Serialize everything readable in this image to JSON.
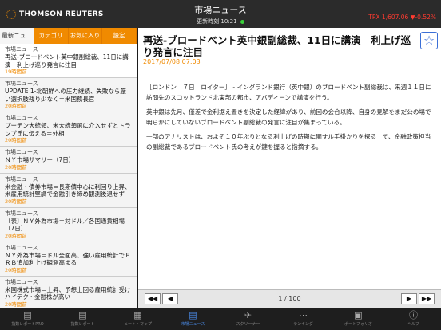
{
  "header": {
    "brand": "THOMSON REUTERS",
    "title": "市場ニュース",
    "updated_label": "更新時刻",
    "updated_time": "10:21",
    "ticker": "TPX 1,607.06 ▼-0.52%"
  },
  "tabs": [
    {
      "label": "最新ニュ..."
    },
    {
      "label": "カテゴリ"
    },
    {
      "label": "お気に入り"
    },
    {
      "label": "設定"
    }
  ],
  "news": [
    {
      "source": "市場ニュース",
      "title": "再送-ブロードベント英中銀副総裁、11日に講演　利上げ巡り発言に注目",
      "age": "19時間前"
    },
    {
      "source": "市場ニュース",
      "title": "UPDATE 1-北朝鮮への圧力継続、失敗なら厳い選択肢残り少なく＝米国務長官",
      "age": "20時間前"
    },
    {
      "source": "市場ニュース",
      "title": "プーチン大統領、米大統領選に介入せずとトランプ氏に伝える＝外相",
      "age": "20時間前"
    },
    {
      "source": "市場ニュース",
      "title": "ＮＹ市場サマリー（7日）",
      "age": "20時間前"
    },
    {
      "source": "市場ニュース",
      "title": "米金融・債券市場＝長期債中心に利回り上昇、米雇用統計堅調で金融引き締め観測後退せず",
      "age": "20時間前"
    },
    {
      "source": "市場ニュース",
      "title": "〔表〕ＮＹ外為市場＝対ドル／各国通貨相場（7日）",
      "age": "20時間前"
    },
    {
      "source": "市場ニュース",
      "title": "ＮＹ外為市場＝ドル全面高、強い雇用統計でＦＲＢ追加利上げ観測高まる",
      "age": "20時間前"
    },
    {
      "source": "市場ニュース",
      "title": "米国株式市場＝上昇、予想上回る雇用統計受け　ハイテク・金融株が高い",
      "age": "20時間前"
    }
  ],
  "article": {
    "title": "再送-ブロードベント英中銀副総裁、11日に講演　利上げ巡り発言に注目",
    "date": "2017/07/08 07:03",
    "paragraphs": [
      "［ロンドン　７日　ロイター］ - イングランド銀行（英中銀）のブロードベント副総裁は、来週１１日に訪問先のスコットランド北東部の都市、アバディーンで講演を行う。",
      "英中銀は先月、僅差で金利据え置きを決定した経緯があり、前回の会合以降、自身の見解をまだ公の場で明らかにしていないブロードベント副総裁の発言に注目が集まっている。",
      "一部のアナリストは、およそ１０年ぶりとなる利上げの時期に関すル手掛かりを探る上で、金融政策担当の副総裁であるブロードベント氏の考えが鍵を握ると指摘する。"
    ]
  },
  "pager": {
    "first": "◀◀",
    "prev": "◀",
    "text": "1 / 100",
    "next": "▶",
    "last": "▶▶"
  },
  "bottom_tabs": [
    {
      "label": "指数レポートPRO",
      "icon": "▤"
    },
    {
      "label": "指数レポート",
      "icon": "▤"
    },
    {
      "label": "ヒート・マップ",
      "icon": "▦"
    },
    {
      "label": "市場ニュース",
      "icon": "▤"
    },
    {
      "label": "スクリーナー",
      "icon": "✈"
    },
    {
      "label": "ランキング",
      "icon": "⋯"
    },
    {
      "label": "ポートフォリオ",
      "icon": "▣"
    },
    {
      "label": "ヘルプ",
      "icon": "ⓘ"
    }
  ],
  "colors": {
    "accent": "#f08a00",
    "selected_tab": "#4a8be8",
    "ticker_down": "#ff3b30"
  }
}
